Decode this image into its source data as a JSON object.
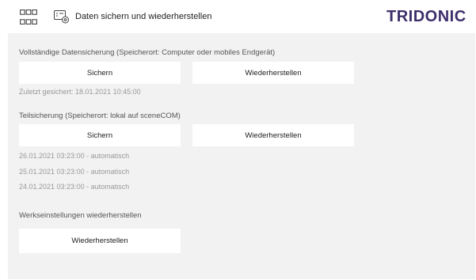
{
  "header": {
    "title": "Daten sichern und wiederherstellen",
    "brand": "TRIDONIC",
    "apps_icon": "grid-apps-icon",
    "backup_icon": "backup-settings-icon",
    "brand_color": "#3d2f6b"
  },
  "full_backup": {
    "title": "Vollständige Datensicherung (Speicherort: Computer oder mobiles Endgerät)",
    "save_label": "Sichern",
    "restore_label": "Wiederherstellen",
    "last_saved": "Zuletzt gesichert: 18.01.2021 10:45:00"
  },
  "partial_backup": {
    "title": "Teilsicherung (Speicherort: lokal auf sceneCOM)",
    "save_label": "Sichern",
    "restore_label": "Wiederherstellen",
    "entries": [
      "26.01.2021 03:23:00 - automatisch",
      "25.01.2021 03:23:00 - automatisch",
      "24.01.2021 03:23:00 - automatisch"
    ]
  },
  "factory": {
    "title": "Werkseinstellungen wiederherstellen",
    "restore_label": "Wiederherstellen"
  }
}
